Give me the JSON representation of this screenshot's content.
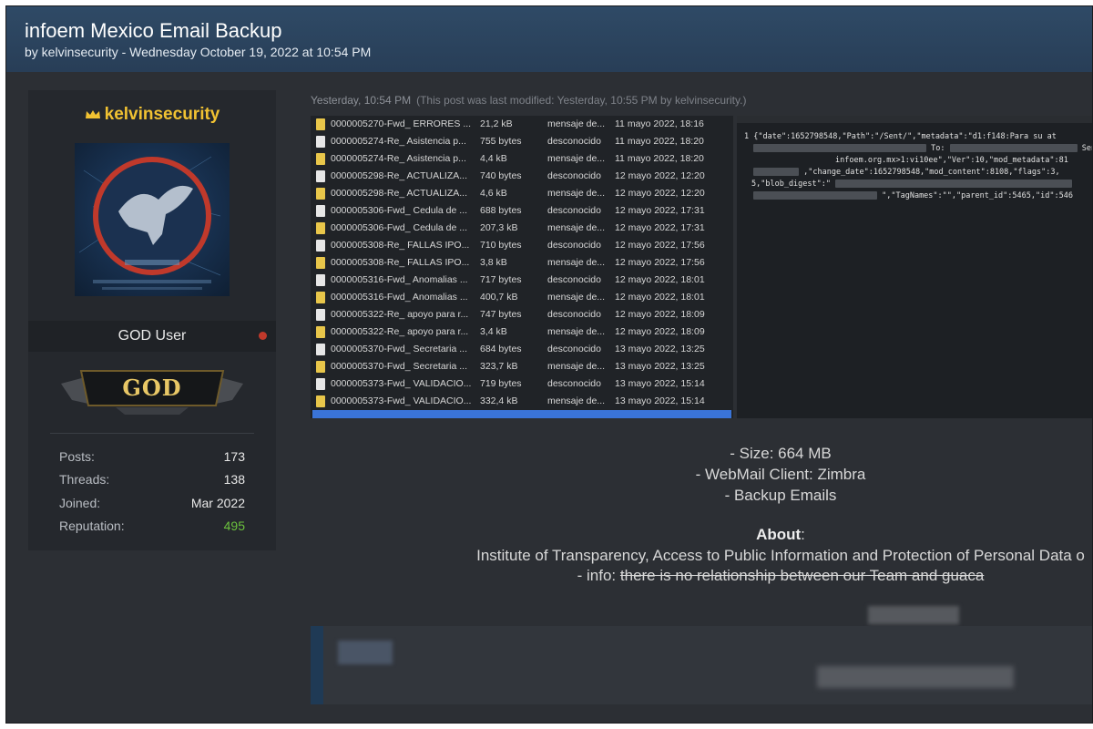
{
  "thread": {
    "title": "infoem Mexico Email Backup",
    "subtitle": "by kelvinsecurity - Wednesday October 19, 2022 at 10:54 PM"
  },
  "user": {
    "username": "kelvinsecurity",
    "usertitle": "GOD User",
    "rank": "GOD",
    "stats": [
      {
        "label": "Posts:",
        "value": "173"
      },
      {
        "label": "Threads:",
        "value": "138"
      },
      {
        "label": "Joined:",
        "value": "Mar 2022"
      },
      {
        "label": "Reputation:",
        "value": "495"
      }
    ],
    "status_color": "#c0392b"
  },
  "post": {
    "time": "Yesterday, 10:54 PM",
    "modified_note": "(This post was last modified: Yesterday, 10:55 PM by kelvinsecurity.)",
    "files": [
      {
        "name": "0000005270-Fwd_ ERRORES ...",
        "size": "21,2 kB",
        "type": "mensaje de...",
        "date": "11 mayo 2022, 18:16",
        "icon": "folder-icon"
      },
      {
        "name": "0000005274-Re_ Asistencia p...",
        "size": "755 bytes",
        "type": "desconocido",
        "date": "11 mayo 2022, 18:20",
        "icon": "document-icon"
      },
      {
        "name": "0000005274-Re_ Asistencia p...",
        "size": "4,4 kB",
        "type": "mensaje de...",
        "date": "11 mayo 2022, 18:20",
        "icon": "folder-icon"
      },
      {
        "name": "0000005298-Re_ ACTUALIZA...",
        "size": "740 bytes",
        "type": "desconocido",
        "date": "12 mayo 2022, 12:20",
        "icon": "document-icon"
      },
      {
        "name": "0000005298-Re_ ACTUALIZA...",
        "size": "4,6 kB",
        "type": "mensaje de...",
        "date": "12 mayo 2022, 12:20",
        "icon": "folder-icon"
      },
      {
        "name": "0000005306-Fwd_ Cedula de ...",
        "size": "688 bytes",
        "type": "desconocido",
        "date": "12 mayo 2022, 17:31",
        "icon": "document-icon"
      },
      {
        "name": "0000005306-Fwd_ Cedula de ...",
        "size": "207,3 kB",
        "type": "mensaje de...",
        "date": "12 mayo 2022, 17:31",
        "icon": "folder-icon"
      },
      {
        "name": "0000005308-Re_ FALLAS IPO...",
        "size": "710 bytes",
        "type": "desconocido",
        "date": "12 mayo 2022, 17:56",
        "icon": "document-icon"
      },
      {
        "name": "0000005308-Re_ FALLAS IPO...",
        "size": "3,8 kB",
        "type": "mensaje de...",
        "date": "12 mayo 2022, 17:56",
        "icon": "folder-icon"
      },
      {
        "name": "0000005316-Fwd_ Anomalias ...",
        "size": "717 bytes",
        "type": "desconocido",
        "date": "12 mayo 2022, 18:01",
        "icon": "document-icon"
      },
      {
        "name": "0000005316-Fwd_ Anomalias ...",
        "size": "400,7 kB",
        "type": "mensaje de...",
        "date": "12 mayo 2022, 18:01",
        "icon": "folder-icon"
      },
      {
        "name": "0000005322-Re_ apoyo para r...",
        "size": "747 bytes",
        "type": "desconocido",
        "date": "12 mayo 2022, 18:09",
        "icon": "document-icon"
      },
      {
        "name": "0000005322-Re_ apoyo para r...",
        "size": "3,4 kB",
        "type": "mensaje de...",
        "date": "12 mayo 2022, 18:09",
        "icon": "folder-icon"
      },
      {
        "name": "0000005370-Fwd_ Secretaria ...",
        "size": "684 bytes",
        "type": "desconocido",
        "date": "13 mayo 2022, 13:25",
        "icon": "document-icon"
      },
      {
        "name": "0000005370-Fwd_ Secretaria ...",
        "size": "323,7 kB",
        "type": "mensaje de...",
        "date": "13 mayo 2022, 13:25",
        "icon": "folder-icon"
      },
      {
        "name": "0000005373-Fwd_ VALIDACIO...",
        "size": "719 bytes",
        "type": "desconocido",
        "date": "13 mayo 2022, 15:14",
        "icon": "document-icon"
      },
      {
        "name": "0000005373-Fwd_ VALIDACIO...",
        "size": "332,4 kB",
        "type": "mensaje de...",
        "date": "13 mayo 2022, 15:14",
        "icon": "folder-icon"
      }
    ],
    "json_lines": [
      "1 {\"date\":1652798548,\"Path\":\"/Sent/\",\"metadata\":\"d1:f148:Para su at",
      "To:",
      "Sen",
      "infoem.org.mx>1:vi10ee\",\"Ver\":10,\"mod_metadata\":81",
      ",\"change_date\":1652798548,\"mod_content\":8108,\"flags\":3,",
      "5,\"blob_digest\":\"",
      "\",\"TagNames\":\"\",\"parent_id\":5465,\"id\":546"
    ],
    "description": {
      "size": "- Size: 664 MB",
      "client": "- WebMail Client: Zimbra",
      "backup": "- Backup Emails",
      "about_label": "About",
      "about_colon": ":",
      "about_text": "Institute of Transparency, Access to Public Information and Protection of Personal Data o",
      "info_prefix": "- info: ",
      "info_strike": "there is no relationship between our Team and guaca"
    }
  }
}
